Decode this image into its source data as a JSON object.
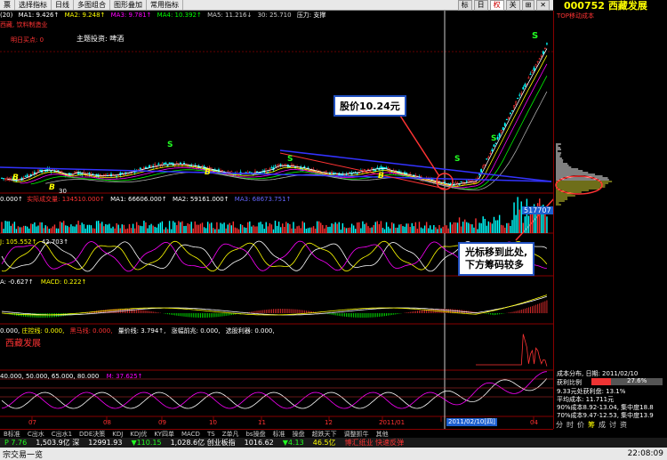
{
  "toolbar": {
    "items": [
      "票",
      "选择指标",
      "日线",
      "多图组合",
      "图形叠加",
      "常用指标"
    ],
    "right_buttons": [
      "标",
      "日",
      "权",
      "关",
      "⊞",
      "✕"
    ]
  },
  "stock": {
    "code": "000752",
    "name": "西藏发展",
    "cost_label": "TOP移动成本"
  },
  "ma_line": {
    "prefix": "(20)",
    "ma1": "MA1: 9.426↑",
    "ma2": "MA2: 9.248↑",
    "ma3": "MA3: 9.781↑",
    "ma4": "MA4: 10.392↑",
    "ma5": "MA5: 11.216↓",
    "ma6": "30: 25.710",
    "pressure": "压力: 支撑"
  },
  "info": {
    "company": "西藏, 饮料制造业",
    "buy_point": "明日买点: 0",
    "theme": "主题投资: 啤酒",
    "num_30": "30"
  },
  "vol_line": {
    "a": "0.000↑",
    "b": "实际成交量: 134510.000↑",
    "c": "MA1: 66606.000↑",
    "d": "MA2: 59161.000↑",
    "e": "MA3: 68673.751↑"
  },
  "vol_box": "517707",
  "kdj_line": {
    "a": "J: 105.552↑",
    "b": "42.703↑"
  },
  "macd_line": {
    "a": "A: -0.627↑",
    "b": "MACD: 0.222↑"
  },
  "chip_line": {
    "a": "0.000, ",
    "b": "庄控线: 0.000,",
    "c": "黑马线: 0.000,",
    "d": "量价线: 3.794↑,",
    "e": "涨幅前兆: 0.000,",
    "f": "选股利器: 0.000,"
  },
  "red_label": "西藏发展",
  "last_line": {
    "a": "40.000, 50.000, 65.000, 80.000",
    "b": "M: 37.625↑"
  },
  "x_dates": [
    "07",
    "08",
    "09",
    "10",
    "11",
    "12",
    "2011/01",
    "2011/02/10[四]",
    "04"
  ],
  "callouts": {
    "price": "股价10.24元",
    "cursor1": "光标移到此处,",
    "cursor2": "下方筹码较多"
  },
  "b_marks": [
    "B",
    "B",
    "B",
    "B"
  ],
  "s_marks": [
    "S",
    "S",
    "S",
    "S",
    "S"
  ],
  "right_panel": {
    "title": "成本分布, 日期: 2011/02/10",
    "profit_label": "获利比例",
    "profit_val": "27.6%",
    "row1": "9.33元处获利盘: 13.1%",
    "row2": "平均成本: 11.711元",
    "row3": "90%成本8.92-13.04, 集中度18.8",
    "row4": "70%成本9.47-12.53, 集中度13.9",
    "tabs": [
      "分",
      "时",
      "价",
      "筹",
      "成",
      "讨",
      "资"
    ]
  },
  "bottom_tabs": [
    "B标准",
    "C出水",
    "C出水1",
    "DDE决策",
    "KDJ",
    "KDJ优",
    "KY四单",
    "MACD",
    "TS",
    "Z单凡",
    "bs操盘",
    "标准",
    "操盘",
    "超跌天下",
    "调整抓牛",
    "其他"
  ],
  "ticker": [
    {
      "t": "P 7.76",
      "c": "#2f2"
    },
    {
      "t": "1,503.9亿 深",
      "c": "#fff"
    },
    {
      "t": "12991.93",
      "c": "#fff"
    },
    {
      "t": "▼110.15",
      "c": "#2f2"
    },
    {
      "t": "1,028.6亿 创业板指",
      "c": "#fff"
    },
    {
      "t": "1016.62",
      "c": "#fff"
    },
    {
      "t": "▼4.13",
      "c": "#2f2"
    },
    {
      "t": "46.5亿",
      "c": "#ff0"
    },
    {
      "t": "博汇纸业 快速反弹",
      "c": "#f33"
    }
  ],
  "status": {
    "left": "宗交易一览",
    "time": "22:08:09"
  }
}
